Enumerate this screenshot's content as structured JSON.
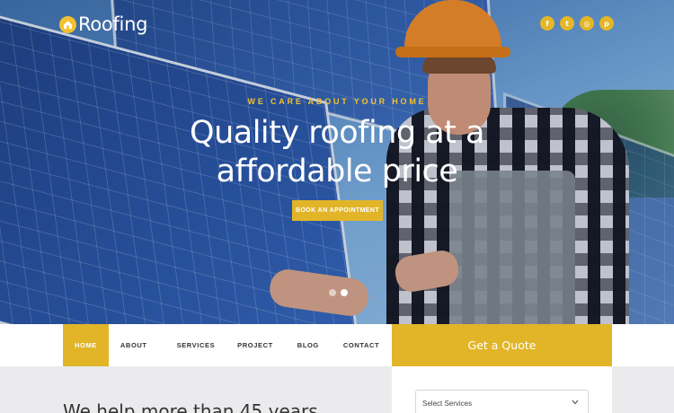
{
  "header": {
    "logo_text": "Roofing",
    "social_icons": [
      "facebook-icon",
      "twitter-icon",
      "instagram-icon",
      "pinterest-icon"
    ],
    "social_glyphs": [
      "f",
      "t",
      "◎",
      "p"
    ]
  },
  "hero": {
    "eyebrow": "WE CARE ABOUT YOUR HOME",
    "headline_line1": "Quality roofing at a",
    "headline_line2": "affordable price",
    "cta_label": "BOOK AN APPOINTMENT",
    "slider_dots": 2,
    "active_slide": 2
  },
  "nav": {
    "items": [
      {
        "label": "HOME",
        "active": true
      },
      {
        "label": "ABOUT"
      },
      {
        "label": "SERVICES"
      },
      {
        "label": "PROJECT"
      },
      {
        "label": "BLOG"
      },
      {
        "label": "CONTACT"
      }
    ]
  },
  "quote": {
    "title": "Get a Quote",
    "select_placeholder": "Select Services"
  },
  "intro": {
    "heading": "We help more than 45 years"
  },
  "colors": {
    "accent": "#e2b529",
    "nav_bg": "#ffffff",
    "page_bg": "#ebebed"
  }
}
